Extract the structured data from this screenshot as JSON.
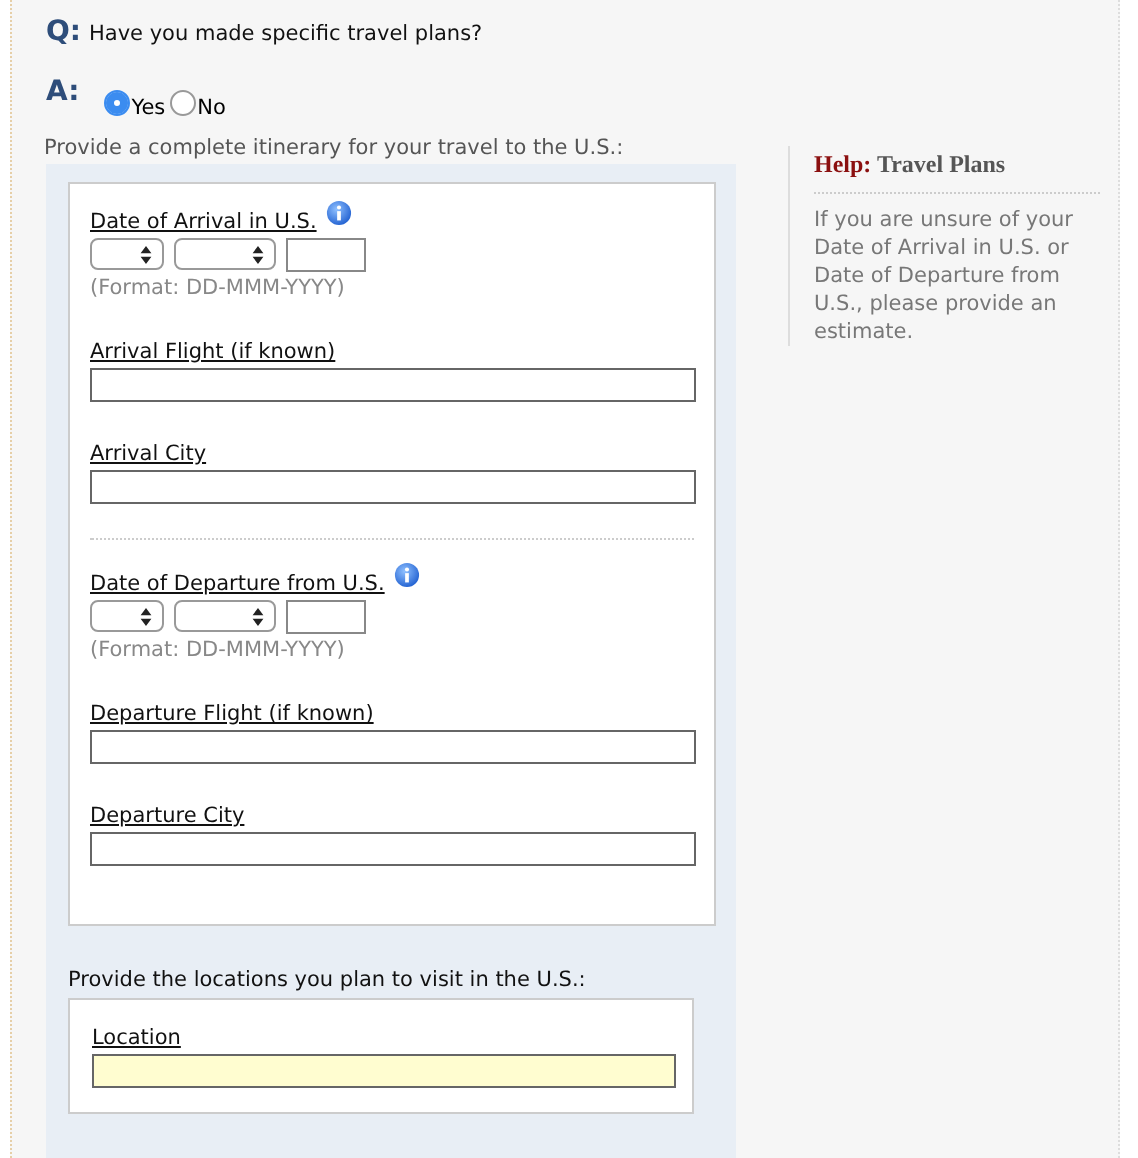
{
  "question": {
    "label": "Q:",
    "text": "Have you made specific travel plans?"
  },
  "answer": {
    "label": "A:",
    "options": [
      {
        "label": "Yes",
        "selected": true
      },
      {
        "label": "No",
        "selected": false
      }
    ]
  },
  "itinerary": {
    "heading": "Provide a complete itinerary for your travel to the U.S.:",
    "groups": [
      [
        {
          "kind": "date",
          "label": "Date of Arrival in U.S.",
          "format": "(Format: DD-MMM-YYYY)"
        },
        {
          "kind": "text",
          "label": "Arrival Flight (if known)"
        },
        {
          "kind": "text",
          "label": "Arrival City"
        }
      ],
      [
        {
          "kind": "date",
          "label": "Date of Departure from U.S.",
          "format": "(Format: DD-MMM-YYYY)"
        },
        {
          "kind": "text",
          "label": "Departure Flight (if known)"
        },
        {
          "kind": "text",
          "label": "Departure City"
        }
      ]
    ]
  },
  "locations": {
    "heading": "Provide the locations you plan to visit in the U.S.:",
    "field_label": "Location"
  },
  "help": {
    "label": "Help:",
    "title": "Travel Plans",
    "text": "If you are unsure of your Date of Arrival in U.S. or Date of Departure from U.S., please provide an estimate."
  }
}
